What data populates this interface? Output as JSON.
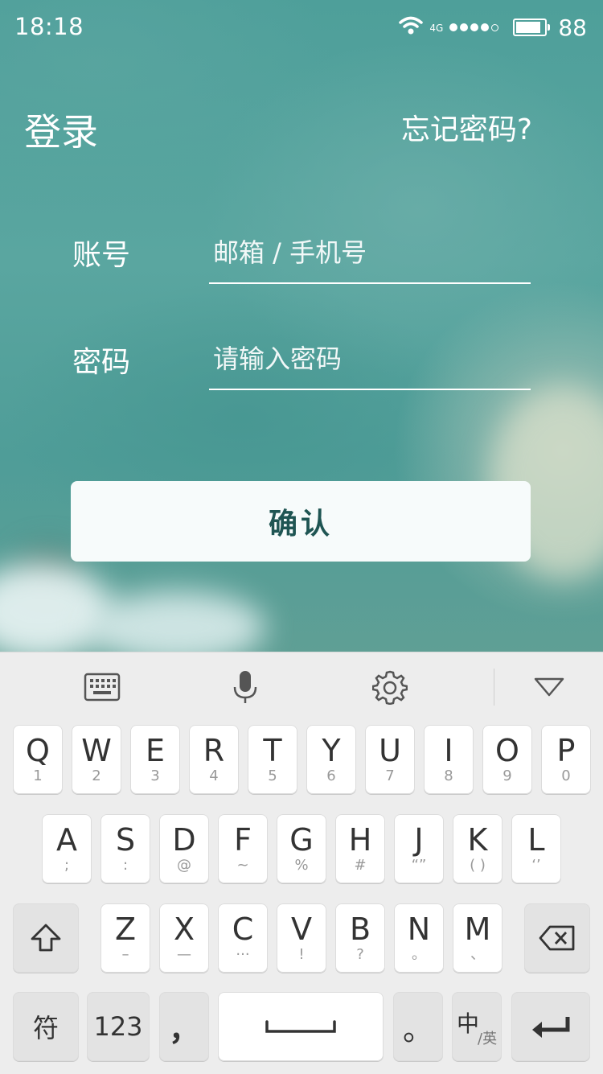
{
  "status_bar": {
    "time": "18:18",
    "network": "4G",
    "battery": "88",
    "battery_level": 0.88
  },
  "header": {
    "title": "登录",
    "forgot_password": "忘记密码?"
  },
  "form": {
    "account_label": "账号",
    "account_placeholder": "邮箱 / 手机号",
    "password_label": "密码",
    "password_placeholder": "请输入密码",
    "confirm_label": "确认"
  },
  "keyboard": {
    "row1": [
      {
        "main": "Q",
        "sub": "1"
      },
      {
        "main": "W",
        "sub": "2"
      },
      {
        "main": "E",
        "sub": "3"
      },
      {
        "main": "R",
        "sub": "4"
      },
      {
        "main": "T",
        "sub": "5"
      },
      {
        "main": "Y",
        "sub": "6"
      },
      {
        "main": "U",
        "sub": "7"
      },
      {
        "main": "I",
        "sub": "8"
      },
      {
        "main": "O",
        "sub": "9"
      },
      {
        "main": "P",
        "sub": "0"
      }
    ],
    "row2": [
      {
        "main": "A",
        "sub": ";"
      },
      {
        "main": "S",
        "sub": ":"
      },
      {
        "main": "D",
        "sub": "@"
      },
      {
        "main": "F",
        "sub": "~"
      },
      {
        "main": "G",
        "sub": "%"
      },
      {
        "main": "H",
        "sub": "#"
      },
      {
        "main": "J",
        "sub": "“”"
      },
      {
        "main": "K",
        "sub": "( )"
      },
      {
        "main": "L",
        "sub": "‘’"
      }
    ],
    "row3": [
      {
        "main": "Z",
        "sub": "–"
      },
      {
        "main": "X",
        "sub": "—"
      },
      {
        "main": "C",
        "sub": "···"
      },
      {
        "main": "V",
        "sub": "!"
      },
      {
        "main": "B",
        "sub": "?"
      },
      {
        "main": "N",
        "sub": "。"
      },
      {
        "main": "M",
        "sub": "、"
      }
    ],
    "symbols_key": "符",
    "numbers_key": "123",
    "comma_key": "，",
    "period_key": "。",
    "lang_key_main": "中",
    "lang_key_sub": "/英"
  }
}
